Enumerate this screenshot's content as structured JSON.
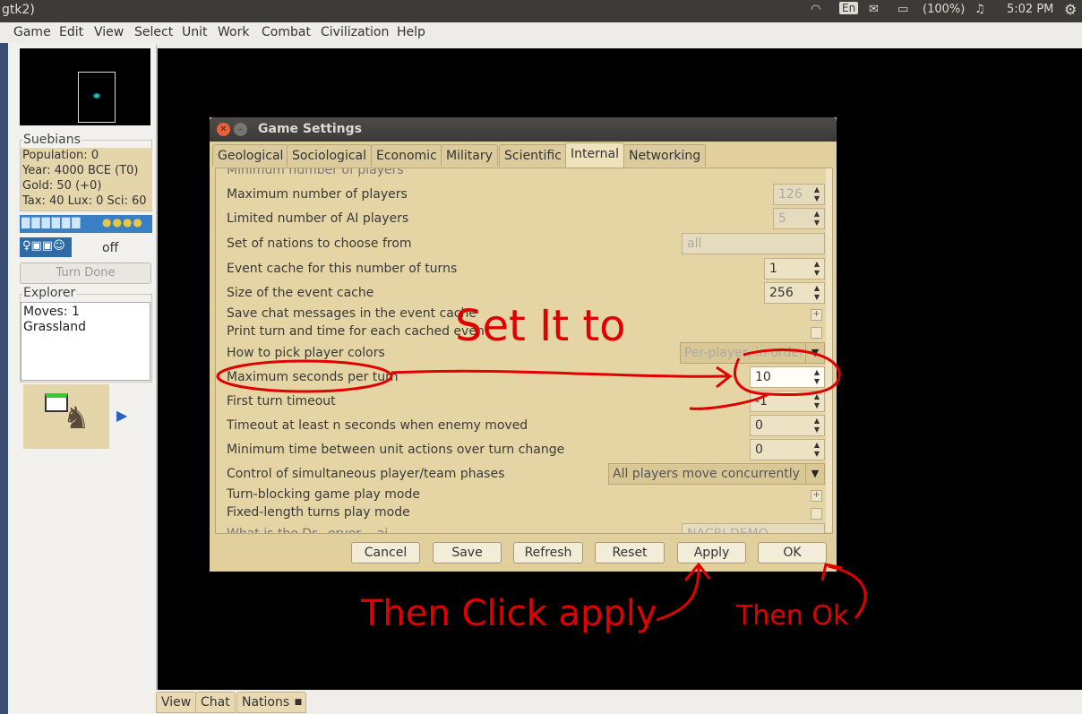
{
  "window_title": "gtk2)",
  "tray": {
    "lang": "En",
    "battery": "(100%)",
    "time": "5:02 PM"
  },
  "menu": [
    "Game",
    "Edit",
    "View",
    "Select",
    "Unit",
    "Work",
    "Combat",
    "Civilization",
    "Help"
  ],
  "player": {
    "nation": "Suebians",
    "population": "Population: 0",
    "year": "Year: 4000 BCE (T0)",
    "gold": "Gold: 50 (+0)",
    "tax": "Tax: 40 Lux: 0 Sci: 60",
    "timeout": "off",
    "turn_done": "Turn Done"
  },
  "explorer": {
    "title": "Explorer",
    "moves": "Moves: 1",
    "terrain": "Grassland"
  },
  "bottom_tabs": [
    "View",
    "Chat",
    "Nations"
  ],
  "dialog": {
    "title": "Game Settings",
    "tabs": [
      "Geological",
      "Sociological",
      "Economic",
      "Military",
      "Scientific",
      "Internal",
      "Networking"
    ],
    "active_tab": "Internal",
    "rows": {
      "min_players": "Minimum number of players",
      "max_players": "Maximum number of players",
      "max_players_val": "126",
      "limited_ai": "Limited number of AI players",
      "limited_ai_val": "5",
      "nations": "Set of nations to choose from",
      "nations_val": "all",
      "event_turns": "Event cache for this number of turns",
      "event_turns_val": "1",
      "event_size": "Size of the event cache",
      "event_size_val": "256",
      "save_chat": "Save chat messages in the event cache",
      "print_turn": "Print turn and time for each cached event",
      "player_colors": "How to pick player colors",
      "player_colors_val": "Per-player, in order",
      "max_seconds": "Maximum seconds per turn",
      "max_seconds_val": "10",
      "first_timeout": "First turn timeout",
      "first_timeout_val": "-1",
      "timeout_enemy": "Timeout at least n seconds when enemy moved",
      "timeout_enemy_val": "0",
      "min_time": "Minimum time between unit actions over turn change",
      "min_time_val": "0",
      "phases": "Control of simultaneous player/team phases",
      "phases_val": "All players move concurrently",
      "turn_blocking": "Turn-blocking game play mode",
      "fixed_length": "Fixed-length turns play mode",
      "metaserver": "What is the Dr...erver ...ai...",
      "metaserver_val": "NACRI DEMO..."
    },
    "buttons": {
      "cancel": "Cancel",
      "save": "Save",
      "refresh": "Refresh",
      "reset": "Reset",
      "apply": "Apply",
      "ok": "OK"
    }
  },
  "annotations": {
    "set_it": "Set It to",
    "click_apply": "Then Click apply",
    "then_ok": "Then Ok"
  }
}
